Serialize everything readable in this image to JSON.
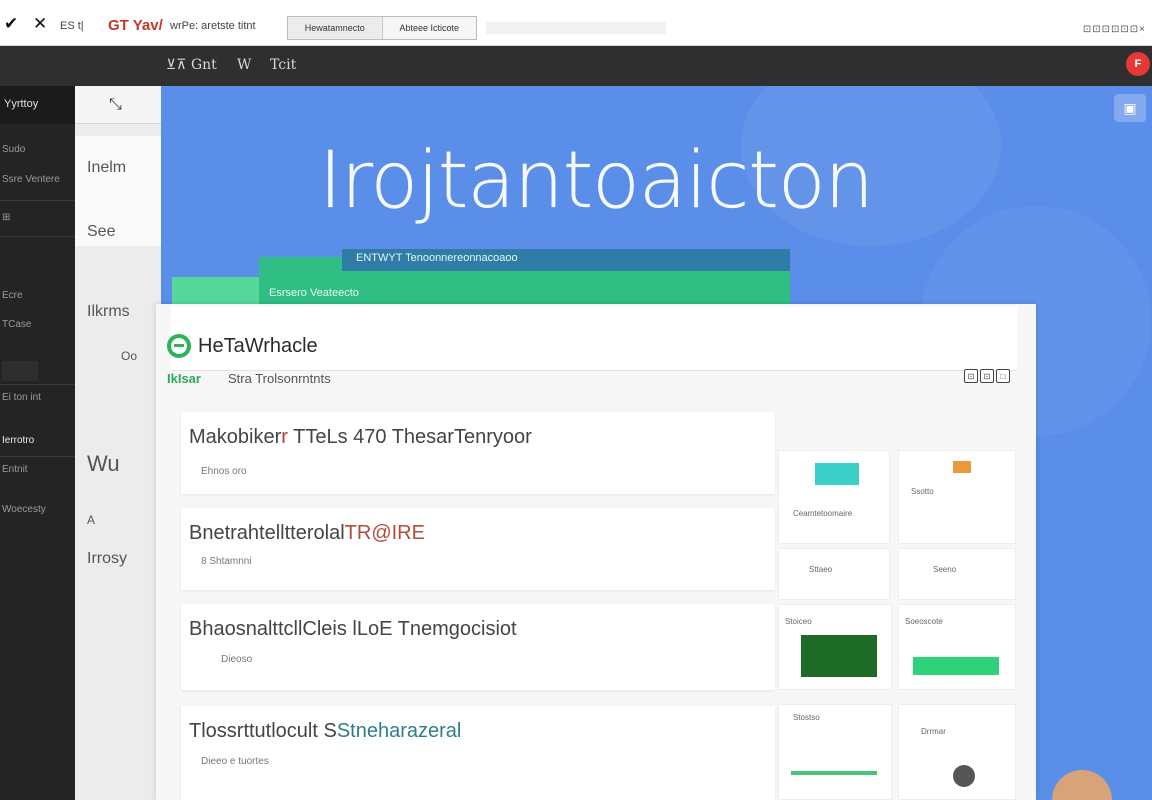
{
  "browser": {
    "back_icon": "back-arrow-icon",
    "close_glyph": "✕",
    "crumb_1": "ES t|",
    "brand": "GT Yav/",
    "crumb_2": "wrPe: aretste  titnt",
    "tabs": [
      "Hewatamnecto",
      "Abteee Icticote"
    ],
    "window_controls": "⊡⊡⊡⊡⊡⊡×"
  },
  "appbar": {
    "items": [
      "⊻⊼  Gnt",
      "W",
      "Tcit"
    ],
    "badge": "F"
  },
  "sidebar": {
    "header": "Yyrttoy",
    "items": [
      "Sudo",
      "Ssre Ventere",
      "⊞",
      "Ecre",
      "TCase",
      "Ei ton  int",
      "Ierrotro",
      "Entnit",
      "Woecesty"
    ]
  },
  "column": {
    "items": [
      "Inelm",
      "See",
      "Ilkrms",
      "Oo",
      "Wu",
      "A",
      "Irrosy"
    ]
  },
  "hero": {
    "title": "Irojtantoaicton",
    "stripe_dark": "ENTWYT  Tenoonnereonnacoaoo",
    "stripe_green": "Esrsero  Veateecto"
  },
  "panel": {
    "title": "HeTaWrhacle",
    "subtitle_tag": "IkIsar",
    "subtitle": "Stra  Trolsonrntnts",
    "actions": [
      "⊡",
      "⊡",
      "□"
    ]
  },
  "cards": [
    {
      "title_a": "Makobiker",
      "title_acc": "r",
      "title_b": " TTeLs 470 ThesarTenryoor",
      "meta": "Ehnos oro"
    },
    {
      "title_a": "Bnetrahtellt",
      "title_b": "terolal",
      "title_acc": "TR@IRE",
      "meta": "8  Shtamnni"
    },
    {
      "title_a": "Bhaosnalttcl",
      "title_b": "lCleis  lLoE Tnemgocisiot",
      "meta": "Dieoso"
    },
    {
      "title_a": "Tlossrttutlocult",
      "title_b": " S",
      "title_acc": "Stneharazeral",
      "meta": "Dieeo e tuortes"
    }
  ],
  "thumbnails": {
    "row1": [
      "Ceamtetoomaire",
      "Ssotto"
    ],
    "row2": [
      "Sttaeo",
      "Seeno"
    ],
    "row3": [
      "Stoiceo",
      "Soeoscote"
    ],
    "row4": [
      "Stostso",
      "Drrmar"
    ]
  }
}
